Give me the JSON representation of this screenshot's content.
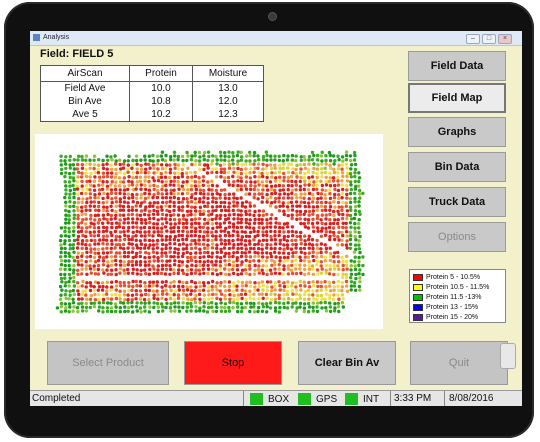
{
  "window": {
    "title": "Analysis"
  },
  "field": {
    "title": "Field: FIELD 5"
  },
  "stats_table": {
    "headers": [
      "AirScan",
      "Protein",
      "Moisture"
    ],
    "rows": [
      {
        "label": "Field Ave",
        "protein": "10.0",
        "moisture": "13.0"
      },
      {
        "label": "Bin Ave",
        "protein": "10.8",
        "moisture": "12.0"
      },
      {
        "label": "Ave 5",
        "protein": "10.2",
        "moisture": "12.3"
      }
    ]
  },
  "side_buttons": {
    "field_data": "Field Data",
    "field_map": "Field Map",
    "graphs": "Graphs",
    "bin_data": "Bin Data",
    "truck_data": "Truck Data",
    "options": "Options"
  },
  "legend": [
    {
      "label": "Protein 5 - 10.5%",
      "color": "#ff0000"
    },
    {
      "label": "Protein 10.5 - 11.5%",
      "color": "#ffff00"
    },
    {
      "label": "Protein 11.5 -13%",
      "color": "#00c000"
    },
    {
      "label": "Protein 13 - 15%",
      "color": "#0000ff"
    },
    {
      "label": "Protein 15 - 20%",
      "color": "#5a1a9a"
    }
  ],
  "bottom_buttons": {
    "select_product": "Select Product",
    "stop": "Stop",
    "clear_bin_av": "Clear Bin Av",
    "quit": "Quit"
  },
  "status": {
    "message": "Completed",
    "indicators": [
      "BOX",
      "GPS",
      "INT"
    ],
    "time": "3:33 PM",
    "date": "8/08/2016"
  },
  "colors": {
    "stop_red": "#ff1a1a",
    "indicator_green": "#1fbf1f",
    "background": "#f3f0cc"
  }
}
